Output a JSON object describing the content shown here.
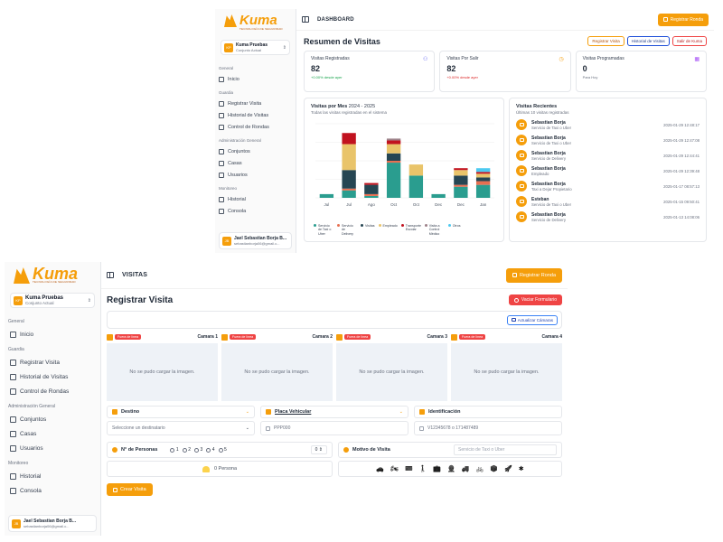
{
  "brand": {
    "name": "Kuma",
    "tagline": "TECNOLOGÍA DE SEGURIDAD"
  },
  "org": {
    "initials": "KP",
    "name": "Kuma Pruebas",
    "sub": "Conjunto Actual"
  },
  "user": {
    "initials": "JB",
    "name": "Jael Sebastian Borja B...",
    "email": "sebastianborja06@gmail.c..."
  },
  "nav": {
    "general_label": "General",
    "inicio": "Inicio",
    "guardia_label": "Guardia",
    "registrar": "Registrar Visita",
    "historial_visitas": "Historial de Visitas",
    "control_rondas": "Control de Rondas",
    "admin_label": "Administración General",
    "conjuntos": "Conjuntos",
    "casas": "Casas",
    "usuarios": "Usuarios",
    "monitoreo_label": "Monitoreo",
    "historial": "Historial",
    "consola": "Consola"
  },
  "top_action": "Registrar Ronda",
  "dashboard": {
    "topbar_title": "DASHBOARD",
    "heading": "Resumen de Visitas",
    "actions": {
      "registrar": "Registrar Visita",
      "historial": "Historial de Visitas",
      "salir": "Salir de Kuma"
    },
    "stats": [
      {
        "label": "Visitas Registradas",
        "value": "82",
        "sub": "+0.00% desde ayer",
        "icon": "user-plus-icon"
      },
      {
        "label": "Visitas Por Salir",
        "value": "82",
        "sub": "+0.00% desde ayer",
        "icon": "clock-icon"
      },
      {
        "label": "Visitas Programadas",
        "value": "0",
        "sub": "Para Hoy",
        "icon": "calendar-icon"
      }
    ],
    "chart_card": {
      "title": "Visitas por Mes",
      "year_range": "2024 - 2025",
      "subtitle": "Todas las visitas registradas en el sistema"
    },
    "recent": {
      "title": "Visitas Recientes",
      "subtitle": "Últimas 10 visitas registradas",
      "items": [
        {
          "name": "Sebastian Borja",
          "type": "Servicio de Taxi o Uber",
          "time": "2025-01-29 12:48:17"
        },
        {
          "name": "Sebastian Borja",
          "type": "Servicio de Taxi o Uber",
          "time": "2025-01-29 12:47:08"
        },
        {
          "name": "Sebastian Borja",
          "type": "Servicio de Delivery",
          "time": "2025-01-29 12:44:41"
        },
        {
          "name": "Sebastian Borja",
          "type": "Empleado",
          "time": "2025-01-29 12:39:48"
        },
        {
          "name": "Sebastian Borja",
          "type": "Taxi a Dejar Propietario",
          "time": "2025-01-17 08:57:13"
        },
        {
          "name": "Esteban",
          "type": "Servicio de Taxi o Uber",
          "time": "2025-01-15 09:50:41"
        },
        {
          "name": "Sebastian Borja",
          "type": "Servicio de Delivery",
          "time": "2025-01-13 14:08:06"
        }
      ]
    }
  },
  "chart_data": {
    "type": "bar",
    "stacked": true,
    "title": "Visitas por Mes",
    "subtitle": "Todas las visitas registradas en el sistema",
    "categories": [
      "Jul",
      "Jul",
      "Ago",
      "Oct",
      "Oct",
      "Dec",
      "Dec",
      "Jan"
    ],
    "ylim": [
      0,
      40
    ],
    "grid": true,
    "legend_position": "bottom",
    "series": [
      {
        "name": "Servicio de Taxi o Uber",
        "color": "#2a9d8f",
        "values": [
          2,
          4,
          1,
          19,
          12,
          2,
          6,
          7
        ]
      },
      {
        "name": "Servicio de Delivery",
        "color": "#e76f51",
        "values": [
          0,
          1,
          1,
          1,
          0,
          0,
          1,
          2
        ]
      },
      {
        "name": "Visitas",
        "color": "#264653",
        "values": [
          0,
          10,
          5,
          4,
          0,
          0,
          5,
          2
        ]
      },
      {
        "name": "Empleado",
        "color": "#e9c46a",
        "values": [
          0,
          14,
          0,
          5,
          6,
          0,
          3,
          2
        ]
      },
      {
        "name": "Transporte Escolar",
        "color": "#c1121f",
        "values": [
          0,
          6,
          1,
          2,
          0,
          0,
          1,
          1
        ]
      },
      {
        "name": "Visita a Control Médico",
        "color": "#9d8189",
        "values": [
          0,
          0,
          0,
          1,
          0,
          0,
          0,
          0
        ]
      },
      {
        "name": "Otros",
        "color": "#4cc9f0",
        "values": [
          0,
          0,
          0,
          0,
          0,
          0,
          0,
          2
        ]
      }
    ]
  },
  "registro": {
    "topbar_title": "VISITAS",
    "heading": "Registrar Visita",
    "vaciar": "Vaciar Formulario",
    "actualizar": "Actualizar Cámaras",
    "offline_badge": "Fuera de línea",
    "no_image": "No se pudo cargar la imagen.",
    "cameras": [
      "Camara 1",
      "Camara 2",
      "Camara 3",
      "Camara 4"
    ],
    "destino": {
      "label": "Destino",
      "placeholder": "Seleccione un destinatario"
    },
    "placa": {
      "label": "Placa Vehicular",
      "placeholder": "PPP000"
    },
    "identificacion": {
      "label": "Identificación",
      "placeholder": "V12345678 o 171487489"
    },
    "personas": {
      "label": "N° de Personas",
      "options": [
        "1",
        "2",
        "3",
        "4",
        "5"
      ],
      "select_value": "0",
      "summary": "0 Persona"
    },
    "motivo": {
      "label": "Motivo de Visita",
      "placeholder": "Servicio de Taxi o Uber"
    },
    "vehicle_icons": [
      "car-icon",
      "motorcycle-icon",
      "person-badge-icon",
      "walking-icon",
      "suitcase-icon",
      "worker-icon",
      "truck-icon",
      "bicycle-icon",
      "box-icon",
      "rocket-icon",
      "misc-icon"
    ],
    "crear": "Crear Visita"
  }
}
